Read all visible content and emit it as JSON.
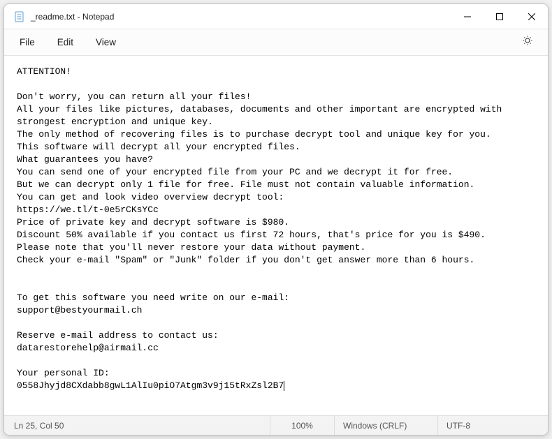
{
  "window": {
    "title": "_readme.txt - Notepad"
  },
  "menu": {
    "file": "File",
    "edit": "Edit",
    "view": "View"
  },
  "document": {
    "lines": [
      "ATTENTION!",
      "",
      "Don't worry, you can return all your files!",
      "All your files like pictures, databases, documents and other important are encrypted with",
      "strongest encryption and unique key.",
      "The only method of recovering files is to purchase decrypt tool and unique key for you.",
      "This software will decrypt all your encrypted files.",
      "What guarantees you have?",
      "You can send one of your encrypted file from your PC and we decrypt it for free.",
      "But we can decrypt only 1 file for free. File must not contain valuable information.",
      "You can get and look video overview decrypt tool:",
      "https://we.tl/t-0e5rCKsYCc",
      "Price of private key and decrypt software is $980.",
      "Discount 50% available if you contact us first 72 hours, that's price for you is $490.",
      "Please note that you'll never restore your data without payment.",
      "Check your e-mail \"Spam\" or \"Junk\" folder if you don't get answer more than 6 hours.",
      "",
      "",
      "To get this software you need write on our e-mail:",
      "support@bestyourmail.ch",
      "",
      "Reserve e-mail address to contact us:",
      "datarestorehelp@airmail.cc",
      "",
      "Your personal ID:",
      "0558Jhyjd8CXdabb8gwL1AlIu0piO7Atgm3v9j15tRxZsl2B7"
    ]
  },
  "statusbar": {
    "position": "Ln 25, Col 50",
    "zoom": "100%",
    "eol": "Windows (CRLF)",
    "encoding": "UTF-8"
  }
}
